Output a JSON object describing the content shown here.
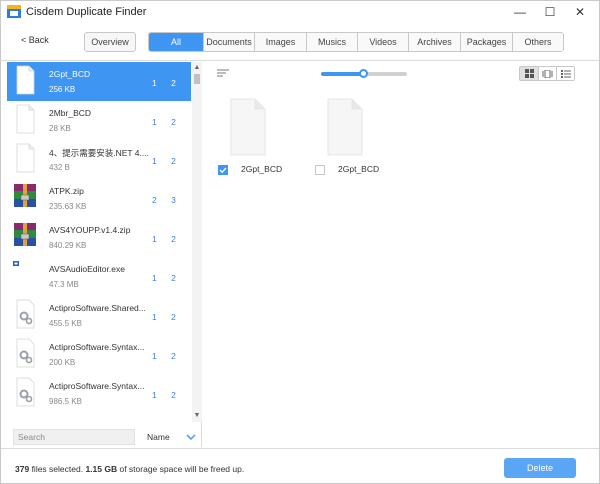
{
  "app": {
    "title": "Cisdem Duplicate Finder",
    "controls": {
      "minimize": "—",
      "maximize": "☐",
      "close": "✕"
    }
  },
  "toolbar": {
    "back_label": "< Back",
    "overview_label": "Overview",
    "tabs": [
      {
        "label": "All",
        "active": true
      },
      {
        "label": "Documents",
        "active": false
      },
      {
        "label": "Images",
        "active": false
      },
      {
        "label": "Musics",
        "active": false
      },
      {
        "label": "Videos",
        "active": false
      },
      {
        "label": "Archives",
        "active": false
      },
      {
        "label": "Packages",
        "active": false
      },
      {
        "label": "Others",
        "active": false
      }
    ]
  },
  "file_list": {
    "items": [
      {
        "name": "2Gpt_BCD",
        "size": "256 KB",
        "count": "1 2",
        "icon": "blank-document-icon",
        "selected": true
      },
      {
        "name": "2Mbr_BCD",
        "size": "28 KB",
        "count": "1 2",
        "icon": "blank-document-icon",
        "selected": false
      },
      {
        "name": "4、提示需要安装.NET 4....",
        "size": "432 B",
        "count": "1 2",
        "icon": "blank-document-icon",
        "selected": false
      },
      {
        "name": "ATPK.zip",
        "size": "235.63 KB",
        "count": "2 3",
        "icon": "winrar-archive-icon",
        "selected": false
      },
      {
        "name": "AVS4YOUPP.v1.4.zip",
        "size": "840.29 KB",
        "count": "1 2",
        "icon": "winrar-archive-icon",
        "selected": false
      },
      {
        "name": "AVSAudioEditor.exe",
        "size": "47.3 MB",
        "count": "1 2",
        "icon": "executable-icon",
        "selected": false
      },
      {
        "name": "ActiproSoftware.Shared...",
        "size": "455.5 KB",
        "count": "1 2",
        "icon": "dll-gear-document-icon",
        "selected": false
      },
      {
        "name": "ActiproSoftware.Syntax...",
        "size": "200 KB",
        "count": "1 2",
        "icon": "dll-gear-document-icon",
        "selected": false
      },
      {
        "name": "ActiproSoftware.Syntax...",
        "size": "986.5 KB",
        "count": "1 2",
        "icon": "dll-gear-document-icon",
        "selected": false
      }
    ],
    "search_placeholder": "Search",
    "sort_label": "Name"
  },
  "detail": {
    "zoom_level": 0.5,
    "view_modes": [
      "grid-view-icon",
      "coverflow-view-icon",
      "list-view-icon"
    ],
    "active_view": 0,
    "files": [
      {
        "name": "2Gpt_BCD",
        "checked": true
      },
      {
        "name": "2Gpt_BCD",
        "checked": false
      }
    ]
  },
  "status": {
    "files_selected_count": "379",
    "files_selected_text": "files selected.",
    "space_value": "1.15 GB",
    "space_text": "of storage space will be freed up."
  },
  "actions": {
    "delete_label": "Delete"
  },
  "colors": {
    "accent": "#3e95f2",
    "delete": "#5aa6f4",
    "count": "#3e7fd8"
  }
}
